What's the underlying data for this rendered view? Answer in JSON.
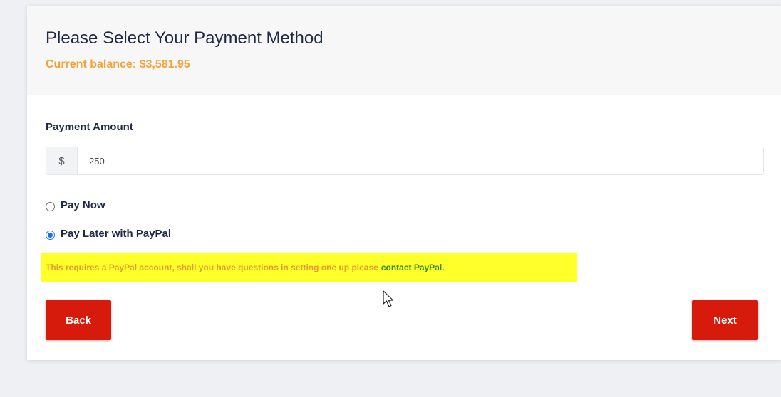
{
  "header": {
    "title": "Please Select Your Payment Method",
    "balance": "Current balance: $3,581.95"
  },
  "payment_amount": {
    "label": "Payment Amount",
    "currency_symbol": "$",
    "value": "250"
  },
  "options": [
    {
      "label": "Pay Now",
      "checked": false
    },
    {
      "label": "Pay Later with PayPal",
      "checked": true
    }
  ],
  "note": {
    "text": "This requires a PayPal account, shall you have questions in setting one up please",
    "link_text": "contact PayPal."
  },
  "buttons": {
    "back": "Back",
    "next": "Next"
  },
  "colors": {
    "accent_red": "#d61a0c",
    "balance_orange": "#f3a23c",
    "highlight_yellow": "#ffff2a",
    "link_green": "#2f8a16"
  }
}
